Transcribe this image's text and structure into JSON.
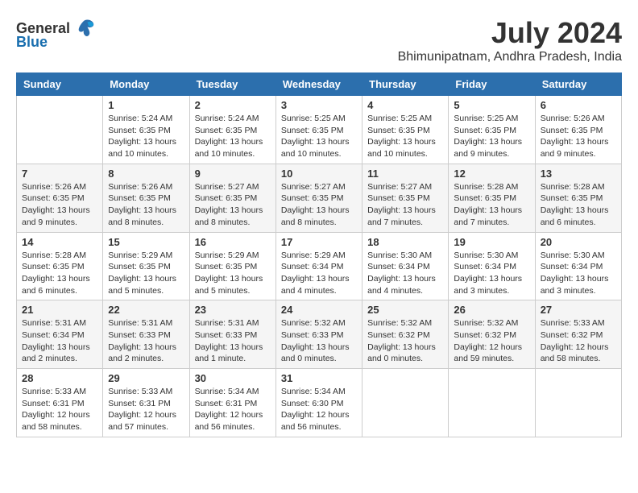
{
  "header": {
    "logo_general": "General",
    "logo_blue": "Blue",
    "month_title": "July 2024",
    "location": "Bhimunipatnam, Andhra Pradesh, India"
  },
  "weekdays": [
    "Sunday",
    "Monday",
    "Tuesday",
    "Wednesday",
    "Thursday",
    "Friday",
    "Saturday"
  ],
  "weeks": [
    [
      {
        "day": "",
        "info": ""
      },
      {
        "day": "1",
        "info": "Sunrise: 5:24 AM\nSunset: 6:35 PM\nDaylight: 13 hours\nand 10 minutes."
      },
      {
        "day": "2",
        "info": "Sunrise: 5:24 AM\nSunset: 6:35 PM\nDaylight: 13 hours\nand 10 minutes."
      },
      {
        "day": "3",
        "info": "Sunrise: 5:25 AM\nSunset: 6:35 PM\nDaylight: 13 hours\nand 10 minutes."
      },
      {
        "day": "4",
        "info": "Sunrise: 5:25 AM\nSunset: 6:35 PM\nDaylight: 13 hours\nand 10 minutes."
      },
      {
        "day": "5",
        "info": "Sunrise: 5:25 AM\nSunset: 6:35 PM\nDaylight: 13 hours\nand 9 minutes."
      },
      {
        "day": "6",
        "info": "Sunrise: 5:26 AM\nSunset: 6:35 PM\nDaylight: 13 hours\nand 9 minutes."
      }
    ],
    [
      {
        "day": "7",
        "info": "Sunrise: 5:26 AM\nSunset: 6:35 PM\nDaylight: 13 hours\nand 9 minutes."
      },
      {
        "day": "8",
        "info": "Sunrise: 5:26 AM\nSunset: 6:35 PM\nDaylight: 13 hours\nand 8 minutes."
      },
      {
        "day": "9",
        "info": "Sunrise: 5:27 AM\nSunset: 6:35 PM\nDaylight: 13 hours\nand 8 minutes."
      },
      {
        "day": "10",
        "info": "Sunrise: 5:27 AM\nSunset: 6:35 PM\nDaylight: 13 hours\nand 8 minutes."
      },
      {
        "day": "11",
        "info": "Sunrise: 5:27 AM\nSunset: 6:35 PM\nDaylight: 13 hours\nand 7 minutes."
      },
      {
        "day": "12",
        "info": "Sunrise: 5:28 AM\nSunset: 6:35 PM\nDaylight: 13 hours\nand 7 minutes."
      },
      {
        "day": "13",
        "info": "Sunrise: 5:28 AM\nSunset: 6:35 PM\nDaylight: 13 hours\nand 6 minutes."
      }
    ],
    [
      {
        "day": "14",
        "info": "Sunrise: 5:28 AM\nSunset: 6:35 PM\nDaylight: 13 hours\nand 6 minutes."
      },
      {
        "day": "15",
        "info": "Sunrise: 5:29 AM\nSunset: 6:35 PM\nDaylight: 13 hours\nand 5 minutes."
      },
      {
        "day": "16",
        "info": "Sunrise: 5:29 AM\nSunset: 6:35 PM\nDaylight: 13 hours\nand 5 minutes."
      },
      {
        "day": "17",
        "info": "Sunrise: 5:29 AM\nSunset: 6:34 PM\nDaylight: 13 hours\nand 4 minutes."
      },
      {
        "day": "18",
        "info": "Sunrise: 5:30 AM\nSunset: 6:34 PM\nDaylight: 13 hours\nand 4 minutes."
      },
      {
        "day": "19",
        "info": "Sunrise: 5:30 AM\nSunset: 6:34 PM\nDaylight: 13 hours\nand 3 minutes."
      },
      {
        "day": "20",
        "info": "Sunrise: 5:30 AM\nSunset: 6:34 PM\nDaylight: 13 hours\nand 3 minutes."
      }
    ],
    [
      {
        "day": "21",
        "info": "Sunrise: 5:31 AM\nSunset: 6:34 PM\nDaylight: 13 hours\nand 2 minutes."
      },
      {
        "day": "22",
        "info": "Sunrise: 5:31 AM\nSunset: 6:33 PM\nDaylight: 13 hours\nand 2 minutes."
      },
      {
        "day": "23",
        "info": "Sunrise: 5:31 AM\nSunset: 6:33 PM\nDaylight: 13 hours\nand 1 minute."
      },
      {
        "day": "24",
        "info": "Sunrise: 5:32 AM\nSunset: 6:33 PM\nDaylight: 13 hours\nand 0 minutes."
      },
      {
        "day": "25",
        "info": "Sunrise: 5:32 AM\nSunset: 6:32 PM\nDaylight: 13 hours\nand 0 minutes."
      },
      {
        "day": "26",
        "info": "Sunrise: 5:32 AM\nSunset: 6:32 PM\nDaylight: 12 hours\nand 59 minutes."
      },
      {
        "day": "27",
        "info": "Sunrise: 5:33 AM\nSunset: 6:32 PM\nDaylight: 12 hours\nand 58 minutes."
      }
    ],
    [
      {
        "day": "28",
        "info": "Sunrise: 5:33 AM\nSunset: 6:31 PM\nDaylight: 12 hours\nand 58 minutes."
      },
      {
        "day": "29",
        "info": "Sunrise: 5:33 AM\nSunset: 6:31 PM\nDaylight: 12 hours\nand 57 minutes."
      },
      {
        "day": "30",
        "info": "Sunrise: 5:34 AM\nSunset: 6:31 PM\nDaylight: 12 hours\nand 56 minutes."
      },
      {
        "day": "31",
        "info": "Sunrise: 5:34 AM\nSunset: 6:30 PM\nDaylight: 12 hours\nand 56 minutes."
      },
      {
        "day": "",
        "info": ""
      },
      {
        "day": "",
        "info": ""
      },
      {
        "day": "",
        "info": ""
      }
    ]
  ]
}
